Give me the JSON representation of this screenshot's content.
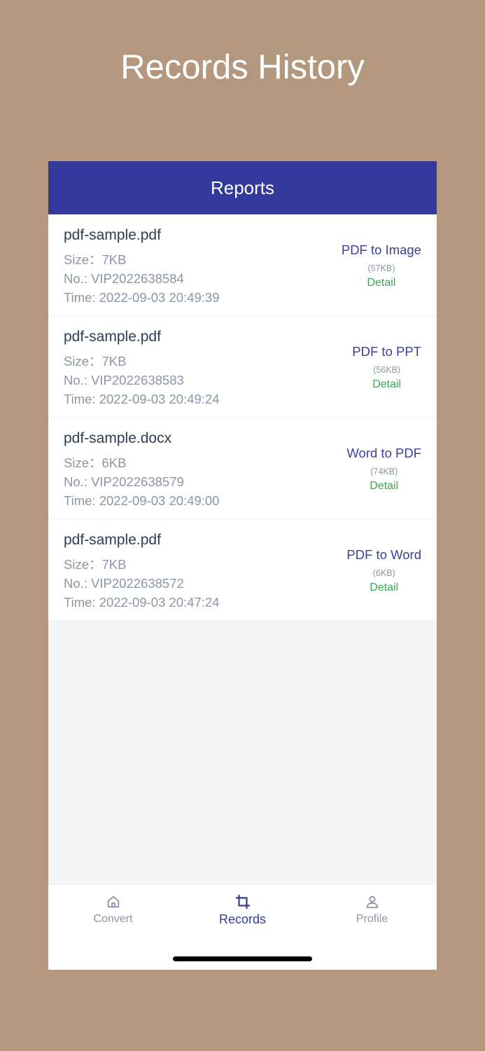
{
  "promo": {
    "title": "Records History"
  },
  "header": {
    "title": "Reports"
  },
  "records": [
    {
      "file_name": "pdf-sample.pdf",
      "size": "Size：7KB",
      "number": "No.: VIP2022638584",
      "time": "Time: 2022-09-03 20:49:39",
      "conversion": "PDF to Image",
      "result_size": "(57KB)",
      "detail_label": "Detail"
    },
    {
      "file_name": "pdf-sample.pdf",
      "size": "Size：7KB",
      "number": "No.: VIP2022638583",
      "time": "Time: 2022-09-03 20:49:24",
      "conversion": "PDF to PPT",
      "result_size": "(56KB)",
      "detail_label": "Detail"
    },
    {
      "file_name": "pdf-sample.docx",
      "size": "Size：6KB",
      "number": "No.: VIP2022638579",
      "time": "Time: 2022-09-03 20:49:00",
      "conversion": "Word to PDF",
      "result_size": "(74KB)",
      "detail_label": "Detail"
    },
    {
      "file_name": "pdf-sample.pdf",
      "size": "Size：7KB",
      "number": "No.: VIP2022638572",
      "time": "Time: 2022-09-03 20:47:24",
      "conversion": "PDF to Word",
      "result_size": "(6KB)",
      "detail_label": "Detail"
    }
  ],
  "tabbar": {
    "tabs": [
      {
        "label": "Convert",
        "icon": "home-icon",
        "active": false
      },
      {
        "label": "Records",
        "icon": "crop-icon",
        "active": true
      },
      {
        "label": "Profile",
        "icon": "user-icon",
        "active": false
      }
    ]
  },
  "colors": {
    "background": "#b3977e",
    "header": "#333a9c",
    "accent": "#333a9c",
    "detail": "#3aa852",
    "muted": "#8b95a6"
  }
}
